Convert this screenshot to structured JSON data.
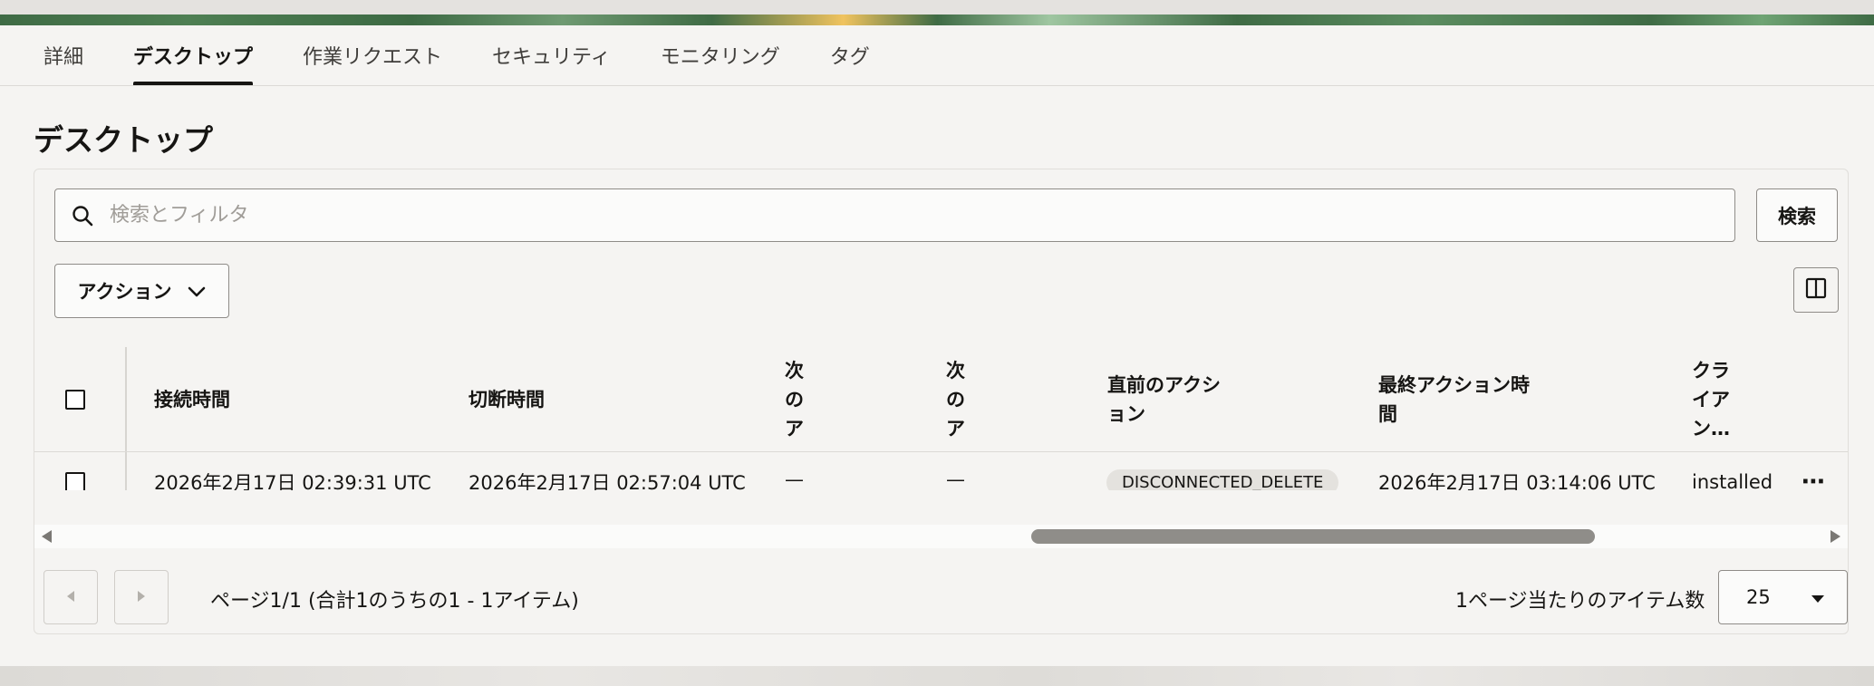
{
  "tabs": [
    {
      "label": "詳細"
    },
    {
      "label": "デスクトップ"
    },
    {
      "label": "作業リクエスト"
    },
    {
      "label": "セキュリティ"
    },
    {
      "label": "モニタリング"
    },
    {
      "label": "タグ"
    }
  ],
  "active_tab": "デスクトップ",
  "page_title": "デスクトップ",
  "search": {
    "placeholder": "検索とフィルタ",
    "value": "",
    "button_label": "検索"
  },
  "actions": {
    "label": "アクション"
  },
  "table": {
    "headers": {
      "connect_time": "接続時間",
      "disconnect_time": "切断時間",
      "next_col1": "次\nの\nア",
      "next_col2": "次\nの\nア",
      "last_action": "直前のアクシ\nョン",
      "last_action_time": "最終アクション時\n間",
      "client": "クラ\nイア\nン…"
    },
    "rows": [
      {
        "connect_time": "2026年2月17日 02:39:31 UTC",
        "disconnect_time": "2026年2月17日 02:57:04 UTC",
        "next_col1": "—",
        "next_col2": "—",
        "last_action": "DISCONNECTED_DELETE",
        "last_action_time": "2026年2月17日 03:14:06 UTC",
        "client": "installed",
        "menu": "⋯"
      }
    ]
  },
  "pagination": {
    "info": "ページ1/1 (合計1のうちの1 - 1アイテム)",
    "per_page_label": "1ページ当たりのアイテム数",
    "per_page_value": "25"
  },
  "colors": {
    "text": "#161513",
    "accent": "#161513",
    "banner": "#3f6b45"
  }
}
